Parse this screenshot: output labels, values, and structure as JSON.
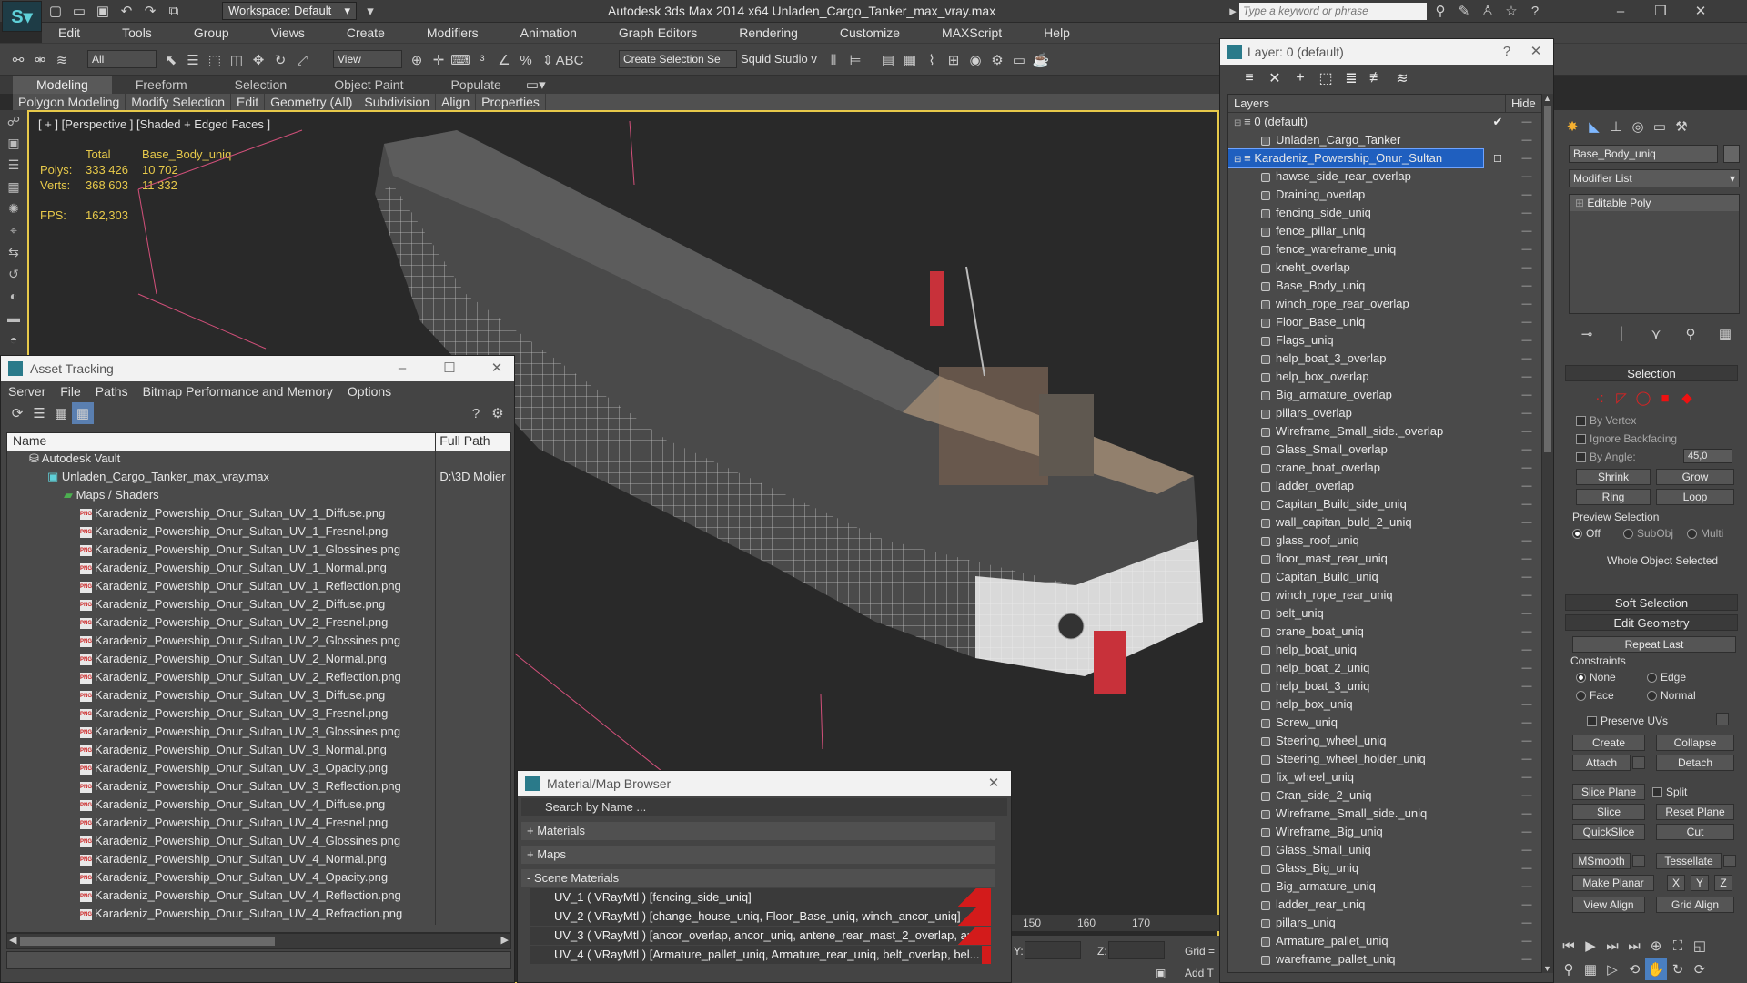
{
  "titlebar": {
    "workspace": "Workspace: Default",
    "title": "Autodesk 3ds Max  2014 x64     Unladen_Cargo_Tanker_max_vray.max",
    "search_placeholder": "Type a keyword or phrase"
  },
  "menu": [
    "Edit",
    "Tools",
    "Group",
    "Views",
    "Create",
    "Modifiers",
    "Animation",
    "Graph Editors",
    "Rendering",
    "Customize",
    "MAXScript",
    "Help"
  ],
  "toolbar": {
    "selection_filter": "All",
    "ref_coord": "View",
    "named_selection": "Create Selection Se",
    "studio_label": "Squid Studio v"
  },
  "ribbon": {
    "tabs": [
      "Modeling",
      "Freeform",
      "Selection",
      "Object Paint",
      "Populate"
    ],
    "active_tab": "Modeling",
    "sub": [
      "Polygon Modeling",
      "Modify Selection",
      "Edit",
      "Geometry (All)",
      "Subdivision",
      "Align",
      "Properties"
    ]
  },
  "viewport": {
    "label": "[ + ] [Perspective ] [Shaded + Edged Faces ]",
    "stats": {
      "total_label": "Total",
      "object_label": "Base_Body_uniq",
      "polys_label": "Polys:",
      "polys_total": "333 426",
      "polys_obj": "10 702",
      "verts_label": "Verts:",
      "verts_total": "368 603",
      "verts_obj": "11 332",
      "fps_label": "FPS:",
      "fps_value": "162,303"
    }
  },
  "asset_tracking": {
    "title": "Asset Tracking",
    "menu": [
      "Server",
      "File",
      "Paths",
      "Bitmap Performance and Memory",
      "Options"
    ],
    "col_name": "Name",
    "col_path": "Full Path",
    "vault": "Autodesk Vault",
    "file": "Unladen_Cargo_Tanker_max_vray.max",
    "file_path": "D:\\3D Molier",
    "maps_group": "Maps / Shaders",
    "maps": [
      "Karadeniz_Powership_Onur_Sultan_UV_1_Diffuse.png",
      "Karadeniz_Powership_Onur_Sultan_UV_1_Fresnel.png",
      "Karadeniz_Powership_Onur_Sultan_UV_1_Glossines.png",
      "Karadeniz_Powership_Onur_Sultan_UV_1_Normal.png",
      "Karadeniz_Powership_Onur_Sultan_UV_1_Reflection.png",
      "Karadeniz_Powership_Onur_Sultan_UV_2_Diffuse.png",
      "Karadeniz_Powership_Onur_Sultan_UV_2_Fresnel.png",
      "Karadeniz_Powership_Onur_Sultan_UV_2_Glossines.png",
      "Karadeniz_Powership_Onur_Sultan_UV_2_Normal.png",
      "Karadeniz_Powership_Onur_Sultan_UV_2_Reflection.png",
      "Karadeniz_Powership_Onur_Sultan_UV_3_Diffuse.png",
      "Karadeniz_Powership_Onur_Sultan_UV_3_Fresnel.png",
      "Karadeniz_Powership_Onur_Sultan_UV_3_Glossines.png",
      "Karadeniz_Powership_Onur_Sultan_UV_3_Normal.png",
      "Karadeniz_Powership_Onur_Sultan_UV_3_Opacity.png",
      "Karadeniz_Powership_Onur_Sultan_UV_3_Reflection.png",
      "Karadeniz_Powership_Onur_Sultan_UV_4_Diffuse.png",
      "Karadeniz_Powership_Onur_Sultan_UV_4_Fresnel.png",
      "Karadeniz_Powership_Onur_Sultan_UV_4_Glossines.png",
      "Karadeniz_Powership_Onur_Sultan_UV_4_Normal.png",
      "Karadeniz_Powership_Onur_Sultan_UV_4_Opacity.png",
      "Karadeniz_Powership_Onur_Sultan_UV_4_Reflection.png",
      "Karadeniz_Powership_Onur_Sultan_UV_4_Refraction.png"
    ]
  },
  "material_browser": {
    "title": "Material/Map Browser",
    "search_placeholder": "Search by Name ...",
    "groups": [
      "+ Materials",
      "+ Maps",
      "- Scene Materials"
    ],
    "materials": [
      "UV_1  ( VRayMtl )  [fencing_side_uniq]",
      "UV_2  ( VRayMtl )  [change_house_uniq, Floor_Base_uniq, winch_ancor_uniq]",
      "UV_3  ( VRayMtl )  [ancor_overlap, ancor_uniq, antene_rear_mast_2_overlap, an...",
      "UV_4  ( VRayMtl )  [Armature_pallet_uniq, Armature_rear_uniq, belt_overlap, bel..."
    ]
  },
  "layers": {
    "title": "Layer: 0 (default)",
    "col_layers": "Layers",
    "col_hide": "Hide",
    "default_layer": "0 (default)",
    "default_child": "Unladen_Cargo_Tanker",
    "selected_layer": "Karadeniz_Powership_Onur_Sultan",
    "objects": [
      "hawse_side_rear_overlap",
      "Draining_overlap",
      "fencing_side_uniq",
      "fence_pillar_uniq",
      "fence_wareframe_uniq",
      "kneht_overlap",
      "Base_Body_uniq",
      "winch_rope_rear_overlap",
      "Floor_Base_uniq",
      "Flags_uniq",
      "help_boat_3_overlap",
      "help_box_overlap",
      "Big_armature_overlap",
      "pillars_overlap",
      "Wireframe_Small_side._overlap",
      "Glass_Small_overlap",
      "crane_boat_overlap",
      "ladder_overlap",
      "Capitan_Build_side_uniq",
      "wall_capitan_buld_2_uniq",
      "glass_roof_uniq",
      "floor_mast_rear_uniq",
      "Capitan_Build_uniq",
      "winch_rope_rear_uniq",
      "belt_uniq",
      "crane_boat_uniq",
      "help_boat_uniq",
      "help_boat_2_uniq",
      "help_boat_3_uniq",
      "help_box_uniq",
      "Screw_uniq",
      "Steering_wheel_uniq",
      "Steering_wheel_holder_uniq",
      "fix_wheel_uniq",
      "Cran_side_2_uniq",
      "Wireframe_Small_side._uniq",
      "Wireframe_Big_uniq",
      "Glass_Small_uniq",
      "Glass_Big_uniq",
      "Big_armature_uniq",
      "ladder_rear_uniq",
      "pillars_uniq",
      "Armature_pallet_uniq",
      "wareframe_pallet_uniq"
    ]
  },
  "command_panel": {
    "object_name": "Base_Body_uniq",
    "modifier_list": "Modifier List",
    "stack_item": "Editable Poly",
    "selection_title": "Selection",
    "by_vertex": "By Vertex",
    "ignore_backfacing": "Ignore Backfacing",
    "by_angle": "By Angle:",
    "angle_value": "45,0",
    "shrink": "Shrink",
    "grow": "Grow",
    "ring": "Ring",
    "loop": "Loop",
    "preview_selection": "Preview Selection",
    "off": "Off",
    "subobj": "SubObj",
    "multi": "Multi",
    "whole_object": "Whole Object Selected",
    "soft_selection": "Soft Selection",
    "edit_geometry": "Edit Geometry",
    "repeat_last": "Repeat Last",
    "constraints": "Constraints",
    "none": "None",
    "edge": "Edge",
    "face": "Face",
    "normal": "Normal",
    "preserve_uvs": "Preserve UVs",
    "create": "Create",
    "collapse": "Collapse",
    "attach": "Attach",
    "detach": "Detach",
    "slice_plane": "Slice Plane",
    "split": "Split",
    "slice": "Slice",
    "reset_plane": "Reset Plane",
    "quickslice": "QuickSlice",
    "cut": "Cut",
    "msmooth": "MSmooth",
    "tessellate": "Tessellate",
    "make_planar": "Make Planar",
    "x": "X",
    "y": "Y",
    "z": "Z",
    "view_align": "View Align",
    "grid_align": "Grid Align"
  },
  "timeline": {
    "ticks": [
      "150",
      "160",
      "170"
    ]
  },
  "coords": {
    "y_label": "Y:",
    "z_label": "Z:",
    "grid_label": "Grid =",
    "add_t": "Add T"
  }
}
